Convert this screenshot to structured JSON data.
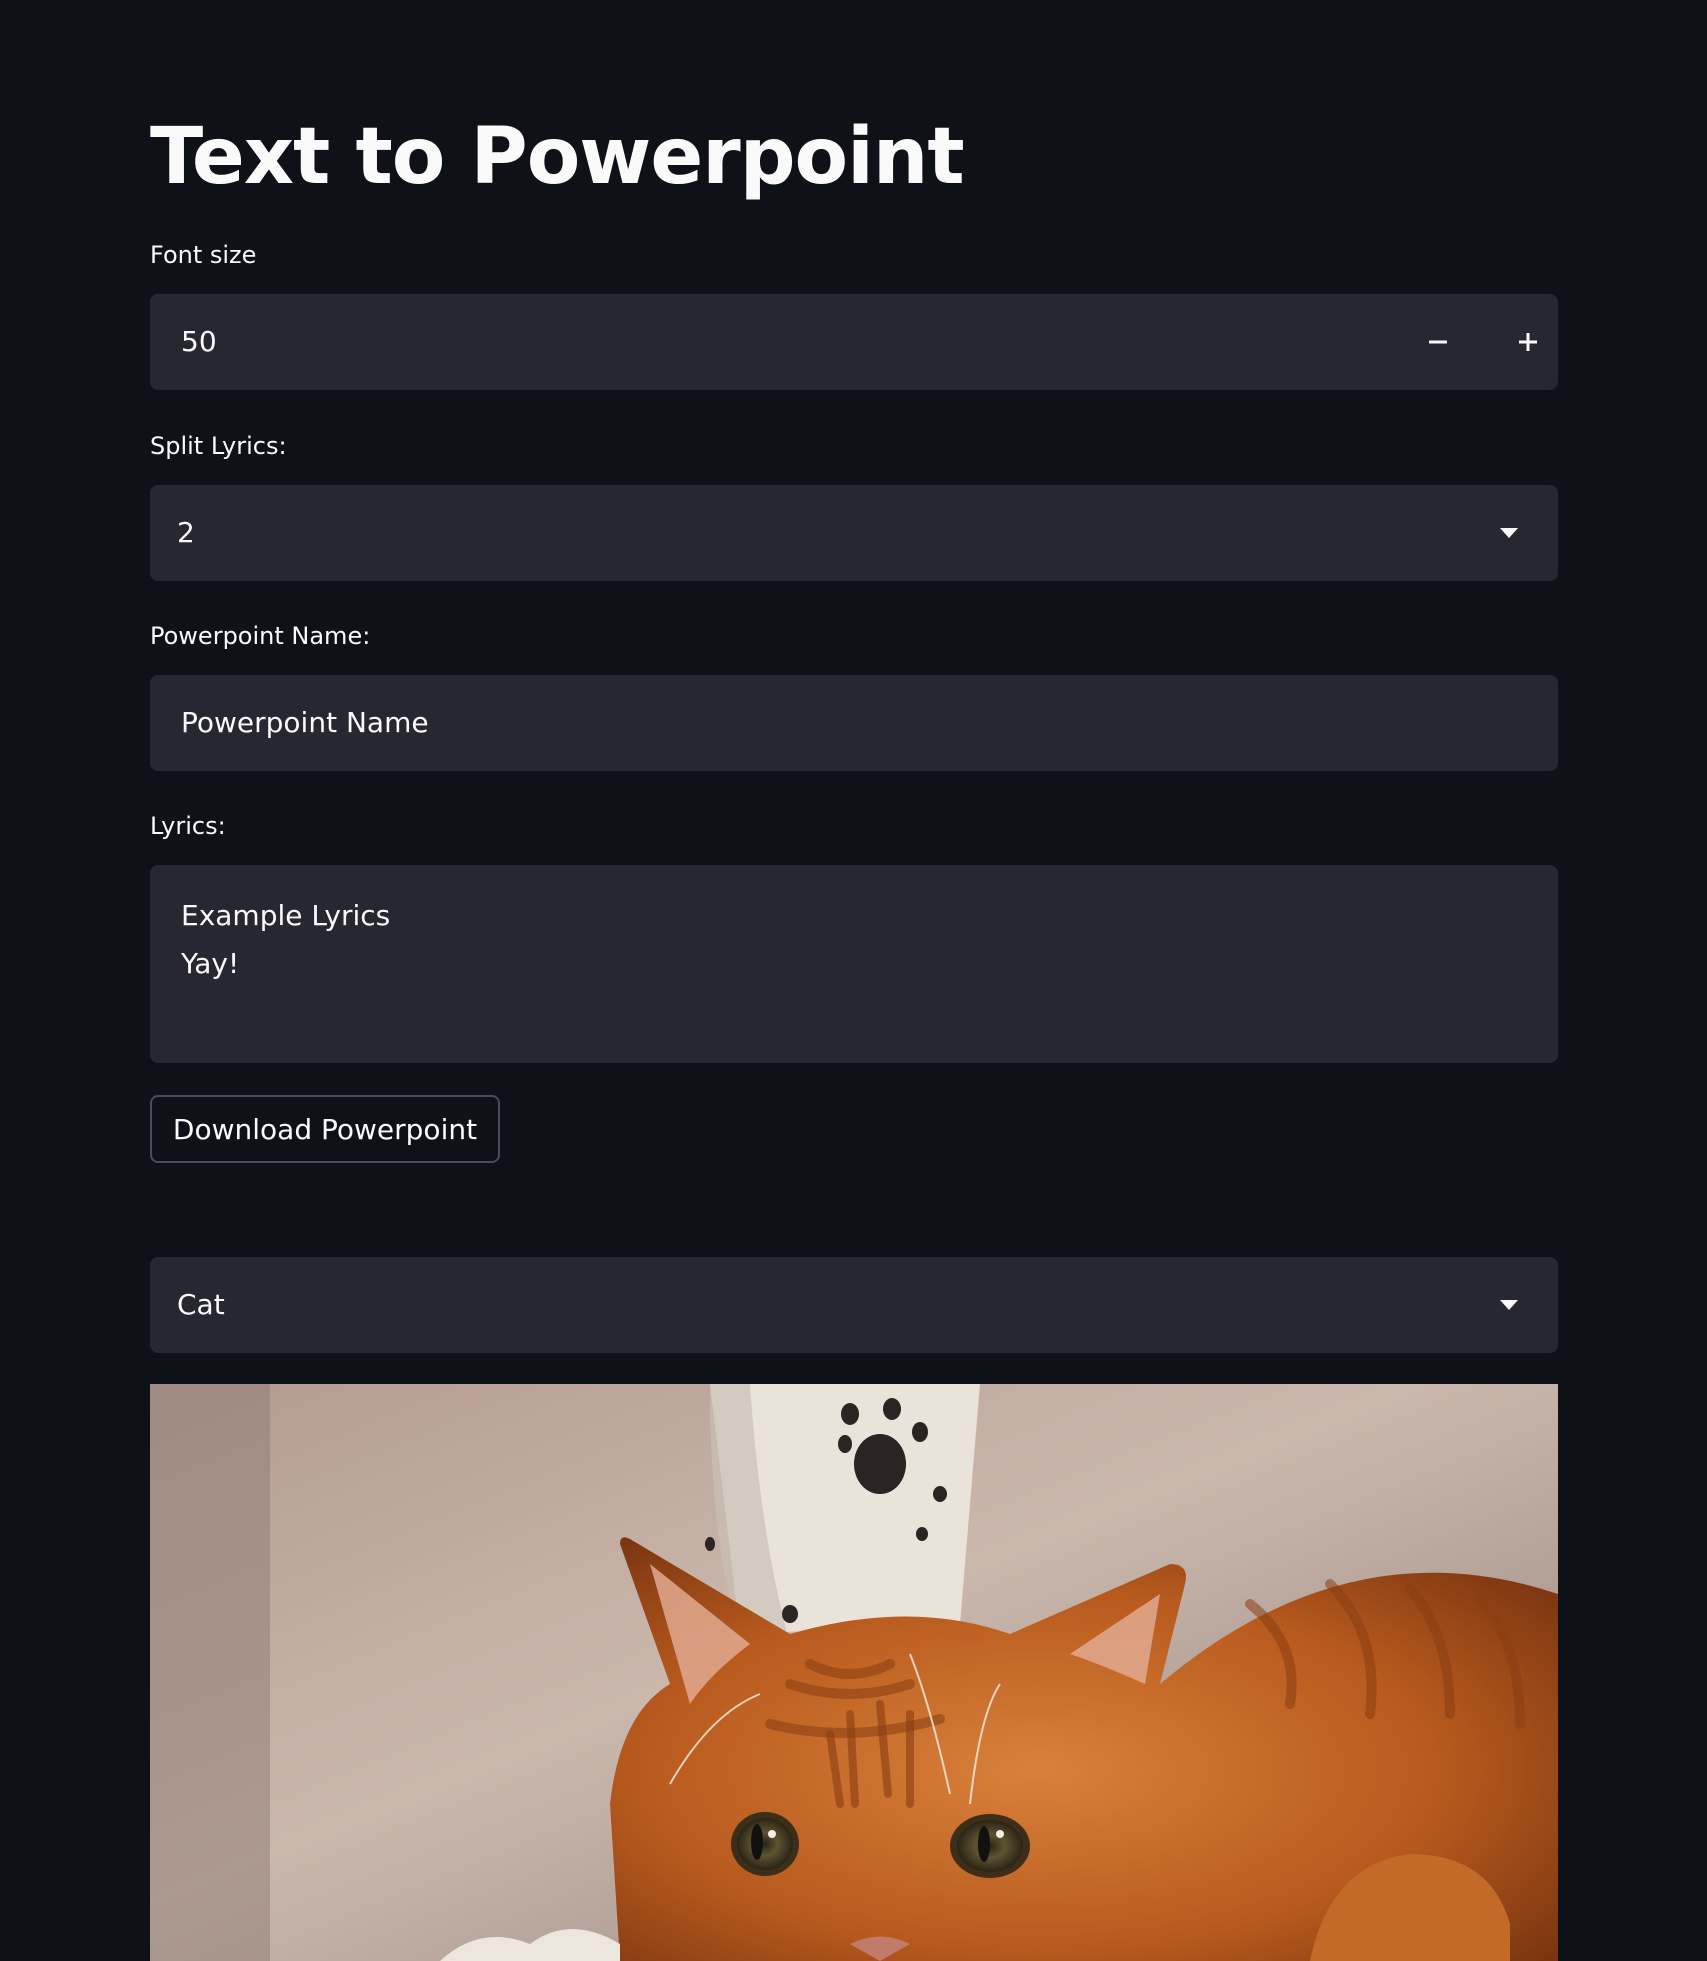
{
  "page": {
    "title": "Text to Powerpoint"
  },
  "font_size": {
    "label": "Font size",
    "value": "50",
    "decrement_icon": "minus-icon",
    "increment_icon": "plus-icon"
  },
  "split_lyrics": {
    "label": "Split Lyrics:",
    "selected": "2",
    "icon": "caret-down-icon"
  },
  "powerpoint_name": {
    "label": "Powerpoint Name:",
    "value": "Powerpoint Name"
  },
  "lyrics": {
    "label": "Lyrics:",
    "lines": [
      "Example Lyrics",
      "Yay!"
    ]
  },
  "download": {
    "label": "Download Powerpoint"
  },
  "image_select": {
    "selected": "Cat",
    "icon": "caret-down-icon"
  },
  "colors": {
    "background": "#0e1117",
    "field": "#262730",
    "text": "#fafafa",
    "button_border": "#4a4c57"
  }
}
